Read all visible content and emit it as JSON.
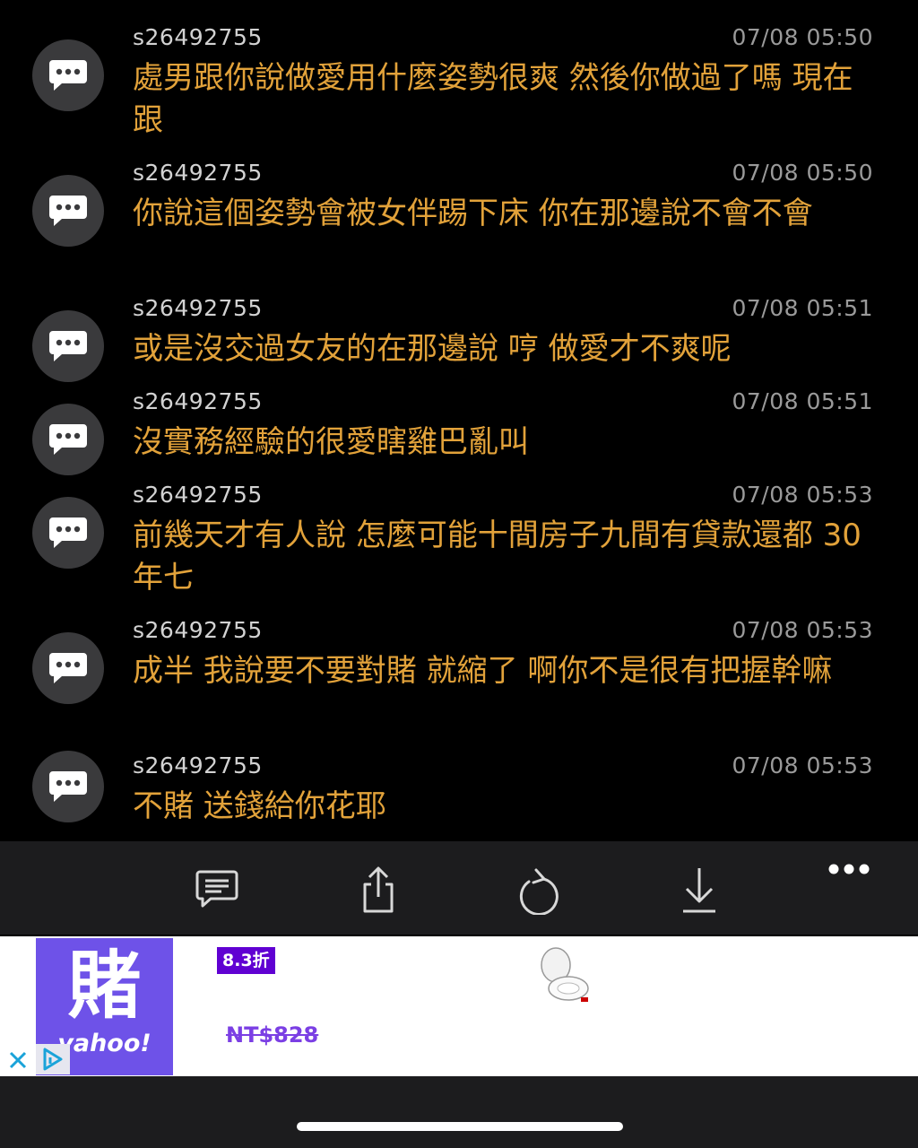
{
  "comments": [
    {
      "author": "s26492755",
      "time": "07/08 05:50",
      "text": "處男跟你說做愛用什麼姿勢很爽 然後你做過了嗎 現在跟"
    },
    {
      "author": "s26492755",
      "time": "07/08 05:50",
      "text": "你說這個姿勢會被女伴踢下床 你在那邊說不會不會"
    },
    {
      "author": "s26492755",
      "time": "07/08 05:51",
      "text": "或是沒交過女友的在那邊說 哼 做愛才不爽呢"
    },
    {
      "author": "s26492755",
      "time": "07/08 05:51",
      "text": "沒實務經驗的很愛瞎雞巴亂叫"
    },
    {
      "author": "s26492755",
      "time": "07/08 05:53",
      "text": "前幾天才有人說 怎麼可能十間房子九間有貸款還都 30 年七"
    },
    {
      "author": "s26492755",
      "time": "07/08 05:53",
      "text": "成半  我說要不要對賭 就縮了 啊你不是很有把握幹嘛"
    },
    {
      "author": "s26492755",
      "time": "07/08 05:53",
      "text": "不賭 送錢給你花耶"
    }
  ],
  "toolbar": {
    "icons": [
      "comment-icon",
      "share-icon",
      "refresh-icon",
      "download-icon",
      "more-icon"
    ]
  },
  "ad": {
    "logo_char": "賭",
    "logo_brand": "yahoo!",
    "badge": "8.3折",
    "price": "NT$828"
  },
  "colors": {
    "accent": "#e2a23a",
    "background": "#000000",
    "toolbar": "#1c1c1e",
    "ad_purple": "#6001d2"
  }
}
